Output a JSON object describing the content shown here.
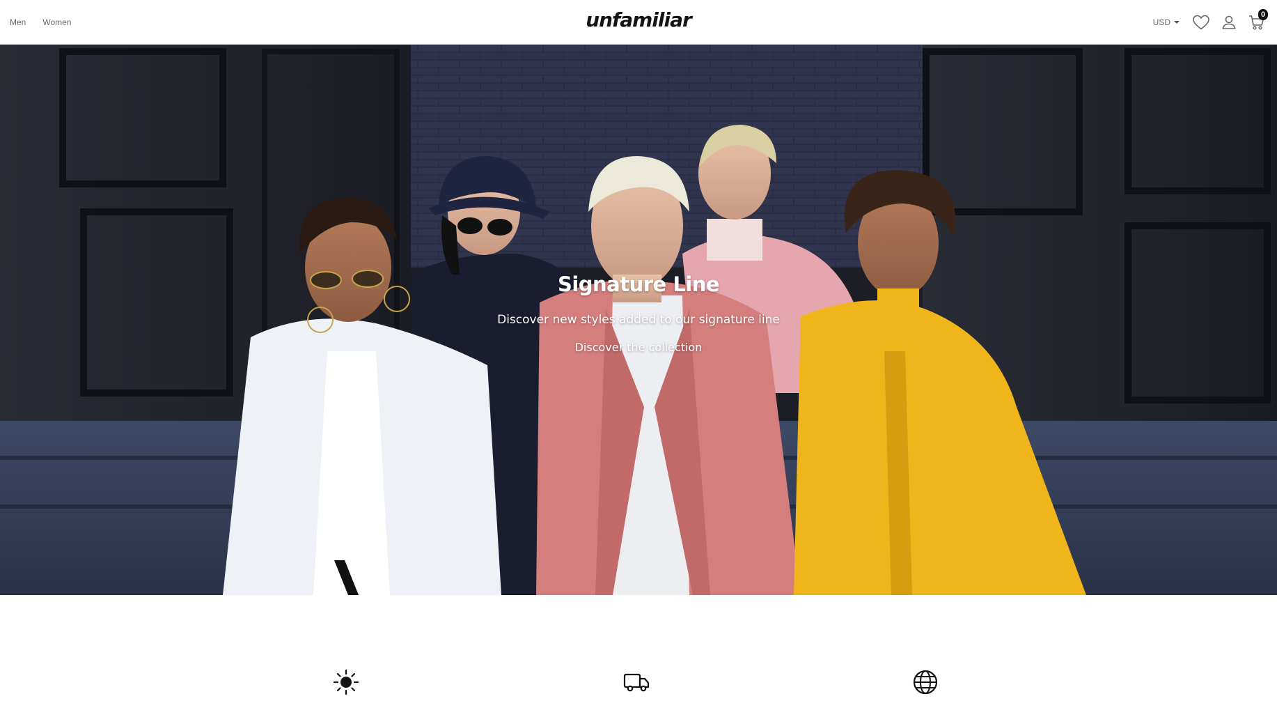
{
  "header": {
    "nav": [
      {
        "label": "Men"
      },
      {
        "label": "Women"
      }
    ],
    "logo": "unfamiliar",
    "currency": "USD",
    "icons": {
      "wishlist": "heart-icon",
      "account": "user-icon",
      "cart": "cart-icon"
    },
    "cart_count": "0"
  },
  "hero": {
    "title": "Signature Line",
    "subtitle": "Discover new styles added to our signature line",
    "link": "Discover the collection",
    "image": "group-of-five-models-in-colorful-track-jackets"
  },
  "features": {
    "icons": [
      "sun-icon",
      "truck-icon",
      "globe-icon"
    ]
  },
  "colors": {
    "accent": "#111111",
    "jacket_white": "#f2f4f8",
    "jacket_pink": "#d98080",
    "jacket_yellow": "#f2b81c",
    "jacket_navy": "#1c2036"
  }
}
